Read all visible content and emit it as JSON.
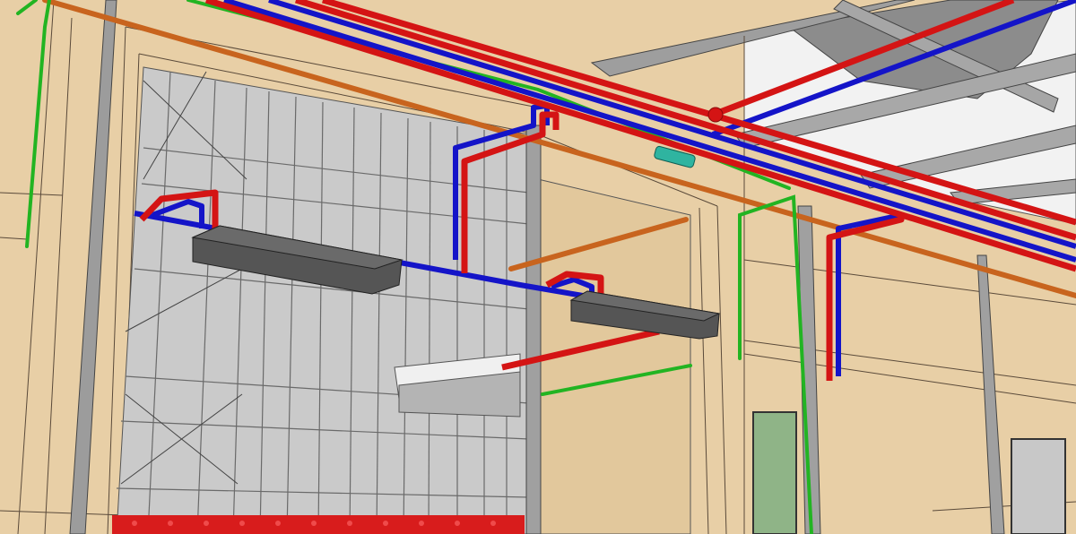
{
  "scene": {
    "kind": "3d-bim-mep-model-view",
    "colors": {
      "wall": "#e8cfa6",
      "wall_shade": "#dcc297",
      "frame_line": "#5a4a3a",
      "steel": "#9a9a9a",
      "steel_dark": "#6e6e6e",
      "sky": "#f4f4f4",
      "glass": "#c9c9c9",
      "glass_line": "#707070",
      "pipe_red": "#d41414",
      "pipe_blue": "#1414c8",
      "pipe_green": "#22b422",
      "pipe_orange": "#c8641e",
      "fan_coil": "#555555",
      "fan_coil_top": "#6a6a6a",
      "door": "#8fb487",
      "door_grey": "#c8c8c8",
      "floor_red": "#d81c1c",
      "teal_fitting": "#2fb4a0"
    },
    "objects": [
      {
        "name": "supply-pipe",
        "color": "red"
      },
      {
        "name": "return-pipe",
        "color": "blue"
      },
      {
        "name": "drain-pipe",
        "color": "green"
      },
      {
        "name": "gas-pipe",
        "color": "orange"
      },
      {
        "name": "fan-coil-unit",
        "count": 2
      },
      {
        "name": "steel-column",
        "count": 3
      },
      {
        "name": "glazed-partition"
      },
      {
        "name": "door",
        "count": 2
      }
    ]
  }
}
